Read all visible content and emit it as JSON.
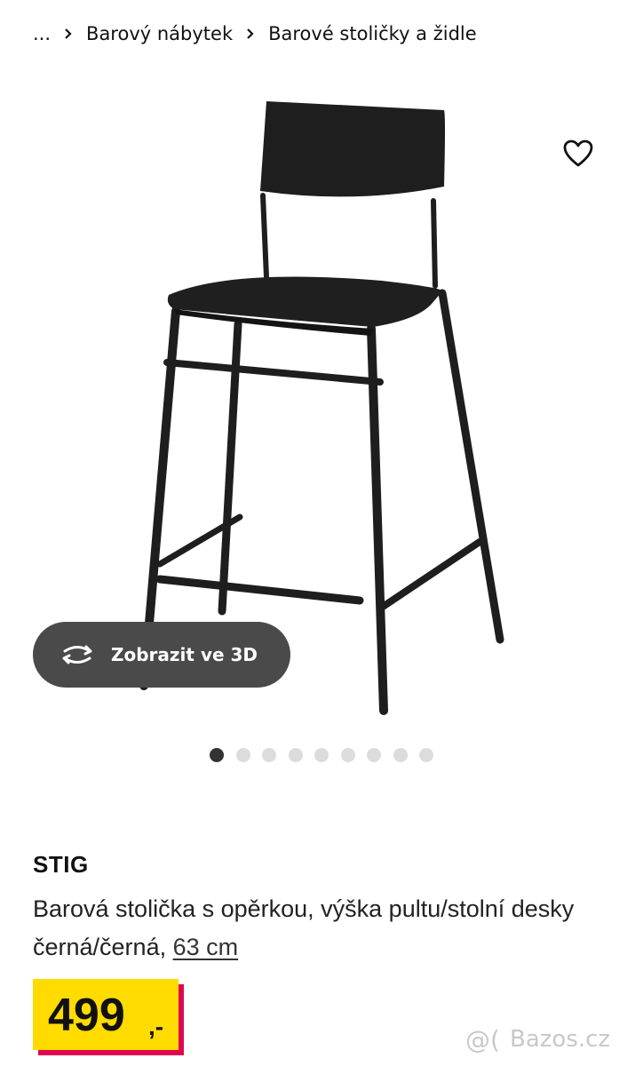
{
  "breadcrumb": {
    "items": [
      "...",
      "Barový nábytek",
      "Barové stoličky a židle"
    ]
  },
  "gallery": {
    "favorite_icon": "heart-outline-icon",
    "view3d_label": "Zobrazit ve 3D",
    "view3d_icon": "rotate-3d-icon",
    "dots_total": 9,
    "active_dot": 1
  },
  "product": {
    "name": "STIG",
    "description": "Barová stolička s opěrkou, výška pultu/stolní desky černá/černá,",
    "size_link": "63 cm",
    "price": "499",
    "price_suffix": ",-"
  },
  "watermark": {
    "text": "Bazos.cz"
  },
  "colors": {
    "price_bg": "#ffdb00",
    "price_shadow": "#e00751",
    "button_bg": "#4a4a4a",
    "dot_active": "#333333",
    "dot_inactive": "#dcdcdc"
  }
}
